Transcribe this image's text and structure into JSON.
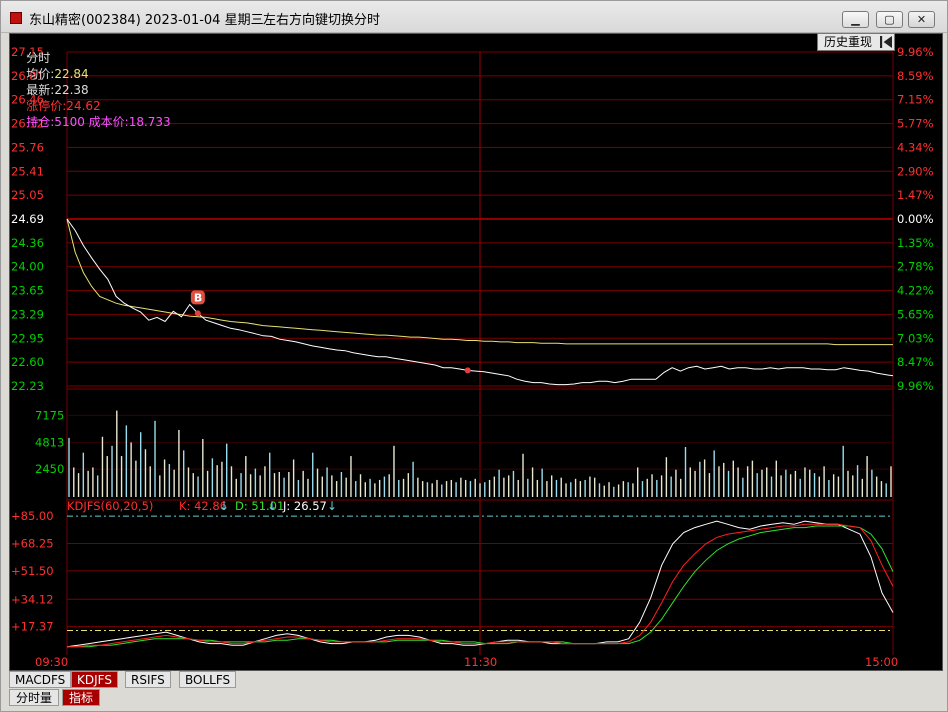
{
  "window": {
    "title": "东山精密(002384) 2023-01-04 星期三",
    "hint": "左右方向键切换分时",
    "min_icon": "minimize-icon",
    "max_icon": "maximize-icon",
    "close_icon": "close-icon"
  },
  "info": {
    "label_fenshi": "分时",
    "label_avg": "均价:",
    "avg_value": "22.84",
    "label_latest": "最新:",
    "latest_value": "22.38",
    "limit_text": "涨停价:24.62",
    "hold_text": "持仓:5100 成本价:18.733"
  },
  "history_button": "历史重现",
  "indicator": {
    "name": "KDJFS(60,20,5)",
    "k": "K: 42.86",
    "d": "D: 51.01",
    "j": "J: 26.57"
  },
  "tabs": [
    "MACDFS",
    "KDJFS",
    "RSIFS",
    "BOLLFS"
  ],
  "active_tab": "KDJFS",
  "bottom_tabs": [
    "分时量",
    "指标"
  ],
  "colors": {
    "up": "#ff3030",
    "down": "#00d000",
    "price": "#ffffff",
    "avg": "#e8e070",
    "volume": "#99ddee",
    "grid": "#7a0000",
    "crosshair": "#a00000"
  },
  "chart_data": [
    {
      "type": "line",
      "title": "",
      "series": [
        {
          "name": "",
          "values": [
            24.69,
            24.52,
            24.3,
            24.12,
            23.95,
            23.8,
            23.55,
            23.45,
            23.38,
            23.32,
            23.2,
            23.24,
            23.18,
            23.33,
            23.25,
            23.43,
            23.3,
            23.2,
            23.16,
            23.12,
            23.08,
            23.06,
            23.03,
            23.0,
            22.97,
            22.96,
            22.92,
            22.9,
            22.88,
            22.85,
            22.82,
            22.8,
            22.78,
            22.76,
            22.75,
            22.72,
            22.7,
            22.68,
            22.66,
            22.66,
            22.64,
            22.62,
            22.6,
            22.58,
            22.56,
            22.54,
            22.5,
            22.5,
            22.48,
            22.46,
            22.45,
            22.44,
            22.42,
            22.4,
            22.38,
            22.33,
            22.3,
            22.28,
            22.28,
            22.26,
            22.25,
            22.25,
            22.26,
            22.28,
            22.28,
            22.3,
            22.3,
            22.28,
            22.3,
            22.33,
            22.33,
            22.33,
            22.33,
            22.43,
            22.5,
            22.45,
            22.5,
            22.52,
            22.48,
            22.5,
            22.52,
            22.48,
            22.5,
            22.5,
            22.48,
            22.48,
            22.5,
            22.48,
            22.5,
            22.5,
            22.5,
            22.48,
            22.48,
            22.47,
            22.47,
            22.5,
            22.48,
            22.46,
            22.45,
            22.42,
            22.4,
            22.38
          ]
        },
        {
          "name": "",
          "values": [
            24.69,
            24.2,
            23.9,
            23.7,
            23.55,
            23.5,
            23.45,
            23.42,
            23.4,
            23.38,
            23.36,
            23.34,
            23.32,
            23.3,
            23.28,
            23.26,
            23.25,
            23.24,
            23.22,
            23.2,
            23.18,
            23.17,
            23.16,
            23.14,
            23.12,
            23.11,
            23.1,
            23.09,
            23.08,
            23.07,
            23.06,
            23.05,
            23.04,
            23.03,
            23.02,
            23.01,
            23.0,
            22.99,
            22.98,
            22.98,
            22.97,
            22.96,
            22.95,
            22.95,
            22.94,
            22.93,
            22.92,
            22.92,
            22.91,
            22.9,
            22.9,
            22.89,
            22.89,
            22.88,
            22.88,
            22.87,
            22.87,
            22.87,
            22.86,
            22.86,
            22.86,
            22.85,
            22.85,
            22.85,
            22.85,
            22.85,
            22.85,
            22.85,
            22.85,
            22.85,
            22.85,
            22.85,
            22.85,
            22.85,
            22.85,
            22.85,
            22.85,
            22.85,
            22.85,
            22.85,
            22.85,
            22.85,
            22.85,
            22.85,
            22.85,
            22.85,
            22.85,
            22.85,
            22.85,
            22.85,
            22.85,
            22.85,
            22.85,
            22.85,
            22.84,
            22.84,
            22.84,
            22.84,
            22.84,
            22.84,
            22.84,
            22.84
          ]
        }
      ],
      "y_ticks_left": [
        "27.15",
        "26.81",
        "26.46",
        "26.12",
        "25.76",
        "25.41",
        "25.05",
        "24.69",
        "24.36",
        "24.00",
        "23.65",
        "23.29",
        "22.95",
        "22.60",
        "22.23"
      ],
      "y_ticks_right": [
        "9.96%",
        "8.59%",
        "7.15%",
        "5.77%",
        "4.34%",
        "2.90%",
        "1.47%",
        "0.00%",
        "1.35%",
        "2.78%",
        "4.22%",
        "5.65%",
        "7.03%",
        "8.47%",
        "9.96%"
      ],
      "ylim": [
        22.23,
        27.15
      ],
      "markers": [
        {
          "label": "B",
          "index": 16
        },
        {
          "label": "",
          "index": 49
        }
      ]
    },
    {
      "type": "bar",
      "title": "",
      "y_ticks": [
        "7175",
        "4813",
        "2450"
      ],
      "ylim": [
        0,
        9500
      ],
      "values": [
        5200,
        2600,
        2100,
        3900,
        2300,
        2600,
        1900,
        5300,
        3600,
        4500,
        7600,
        3600,
        6300,
        4800,
        3200,
        5700,
        4200,
        2700,
        6700,
        1900,
        3300,
        2900,
        2400,
        5900,
        4100,
        2600,
        2100,
        1800,
        5100,
        2300,
        3400,
        2800,
        3100,
        4700,
        2700,
        1600,
        2100,
        3600,
        2000,
        2500,
        1900,
        2700,
        3900,
        2100,
        2200,
        1700,
        2200,
        3300,
        1500,
        2300,
        1600,
        3900,
        2500,
        1800,
        2600,
        1900,
        1400,
        2200,
        1700,
        3600,
        1400,
        2000,
        1300,
        1600,
        1200,
        1500,
        1800,
        2000,
        4500,
        1500,
        1600,
        2100,
        3100,
        1700,
        1400,
        1300,
        1200,
        1500,
        1100,
        1400,
        1500,
        1300,
        1700,
        1500,
        1400,
        1600,
        1200,
        1300,
        1500,
        1800,
        2400,
        1700,
        1900,
        2300,
        1500,
        3800,
        1600,
        2600,
        1500,
        2500,
        1400,
        1900,
        1500,
        1700,
        1200,
        1300,
        1600,
        1400,
        1500,
        1800,
        1700,
        1200,
        1000,
        1300,
        900,
        1100,
        1400,
        1300,
        1200,
        2600,
        1400,
        1600,
        2000,
        1500,
        1900,
        3500,
        1800,
        2400,
        1600,
        4400,
        2600,
        2300,
        3100,
        3300,
        2100,
        4100,
        2700,
        3000,
        2300,
        3200,
        2600,
        1700,
        2700,
        3200,
        2100,
        2400,
        2600,
        1800,
        3200,
        1900,
        2400,
        2000,
        2300,
        1600,
        2600,
        2400,
        2100,
        1800,
        2700,
        1500,
        2000,
        1800,
        4500,
        2300,
        1900,
        2800,
        1600,
        3600,
        2400,
        1800,
        1400,
        1200,
        2700
      ]
    },
    {
      "type": "line",
      "title": "KDJFS(60,20,5)",
      "series": [
        {
          "name": "K",
          "values": [
            5,
            5,
            6,
            6,
            7,
            8,
            9,
            10,
            11,
            12,
            11,
            10,
            9,
            8,
            8,
            7,
            7,
            8,
            9,
            10,
            11,
            11,
            10,
            9,
            8,
            8,
            8,
            8,
            8,
            9,
            10,
            10,
            10,
            9,
            8,
            8,
            7,
            7,
            7,
            8,
            8,
            8,
            8,
            8,
            8,
            7,
            7,
            7,
            7,
            7,
            7,
            8,
            12,
            20,
            32,
            45,
            55,
            62,
            68,
            72,
            74,
            75,
            76,
            77,
            78,
            79,
            79,
            80,
            80,
            80,
            80,
            79,
            78,
            70,
            55,
            42
          ]
        },
        {
          "name": "D",
          "values": [
            5,
            5,
            5,
            6,
            6,
            7,
            8,
            9,
            10,
            10,
            10,
            10,
            9,
            9,
            8,
            8,
            8,
            8,
            8,
            9,
            9,
            10,
            10,
            9,
            9,
            8,
            8,
            8,
            8,
            8,
            9,
            9,
            9,
            9,
            9,
            8,
            8,
            8,
            7,
            7,
            7,
            8,
            8,
            8,
            8,
            8,
            7,
            7,
            7,
            7,
            7,
            7,
            9,
            14,
            22,
            32,
            42,
            51,
            58,
            64,
            68,
            71,
            73,
            75,
            76,
            77,
            78,
            78,
            79,
            79,
            79,
            79,
            78,
            74,
            65,
            51
          ]
        },
        {
          "name": "J",
          "values": [
            5,
            6,
            7,
            8,
            9,
            10,
            11,
            12,
            13,
            14,
            12,
            10,
            8,
            7,
            7,
            6,
            6,
            8,
            10,
            12,
            13,
            12,
            10,
            8,
            7,
            7,
            8,
            8,
            9,
            11,
            12,
            12,
            11,
            9,
            7,
            7,
            6,
            6,
            7,
            8,
            9,
            9,
            8,
            8,
            7,
            7,
            7,
            7,
            7,
            8,
            8,
            10,
            20,
            35,
            55,
            68,
            75,
            78,
            80,
            82,
            80,
            78,
            77,
            79,
            80,
            81,
            80,
            82,
            81,
            80,
            80,
            77,
            74,
            60,
            38,
            26
          ]
        }
      ],
      "y_ticks": [
        "+85.00",
        "+68.25",
        "+51.50",
        "+34.12",
        "+17.37"
      ],
      "ylim": [
        0,
        90
      ],
      "x_ticks": [
        "09:30",
        "11:30",
        "15:00"
      ]
    }
  ]
}
